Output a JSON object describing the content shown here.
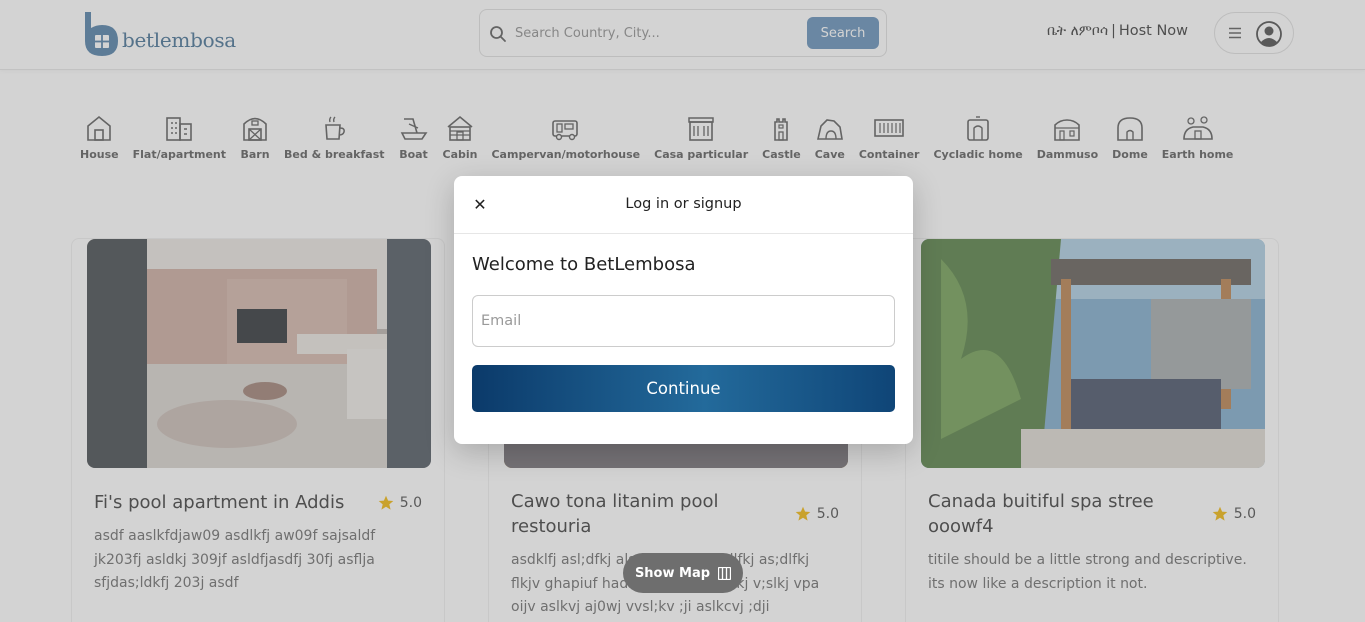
{
  "header": {
    "logo_text": "betlembosa",
    "search": {
      "placeholder": "Search Country, City...",
      "button_label": "Search"
    },
    "host": {
      "amharic_label": "ቤት ለምቦሳ",
      "separator": "|",
      "host_label": "Host Now"
    }
  },
  "categories": [
    {
      "label": "House",
      "icon": "house-icon"
    },
    {
      "label": "Flat/apartment",
      "icon": "building-icon"
    },
    {
      "label": "Barn",
      "icon": "barn-icon"
    },
    {
      "label": "Bed & breakfast",
      "icon": "coffee-icon"
    },
    {
      "label": "Boat",
      "icon": "boat-icon"
    },
    {
      "label": "Cabin",
      "icon": "cabin-icon"
    },
    {
      "label": "Campervan/motorhouse",
      "icon": "campervan-icon"
    },
    {
      "label": "Casa particular",
      "icon": "casa-icon"
    },
    {
      "label": "Castle",
      "icon": "castle-icon"
    },
    {
      "label": "Cave",
      "icon": "cave-icon"
    },
    {
      "label": "Container",
      "icon": "container-icon"
    },
    {
      "label": "Cycladic home",
      "icon": "cycladic-icon"
    },
    {
      "label": "Dammuso",
      "icon": "dammuso-icon"
    },
    {
      "label": "Dome",
      "icon": "dome-icon"
    },
    {
      "label": "Earth home",
      "icon": "earth-home-icon"
    }
  ],
  "listings": [
    {
      "title": "Fi's pool apartment in Addis",
      "rating": "5.0",
      "description": "asdf aaslkfdjaw09 asdlkfj aw09f sajsaldf jk203fj asldkj 309jf asldfjasdfj 30fj asflja sfjdas;ldkfj 203j asdf"
    },
    {
      "title": "Cawo tona litanim pool restouria",
      "rating": "5.0",
      "description": "asdklfj asl;dfkj alsdkfj asdlf;as;dlfkj as;dlfkj flkjv ghapiuf hadsfkj asdl;kfu aslkj v;slkj vpa oijv aslkvj aj0wj vvsl;kv ;ji aslkcvj ;dji"
    },
    {
      "title": "Canada buitiful spa stree ooowf4",
      "rating": "5.0",
      "description": "titile should be a little strong and descriptive. its now like a description it not."
    }
  ],
  "show_map": {
    "label": "Show Map"
  },
  "modal": {
    "close_label": "✕",
    "title": "Log in or signup",
    "welcome": "Welcome to BetLembosa",
    "email_placeholder": "Email",
    "continue_label": "Continue"
  },
  "colors": {
    "brand": "#3d6a8f",
    "search_button": "#5f8bb5",
    "continue_start": "#0b3a6a",
    "continue_mid": "#236a9b",
    "star": "#f0b400"
  }
}
